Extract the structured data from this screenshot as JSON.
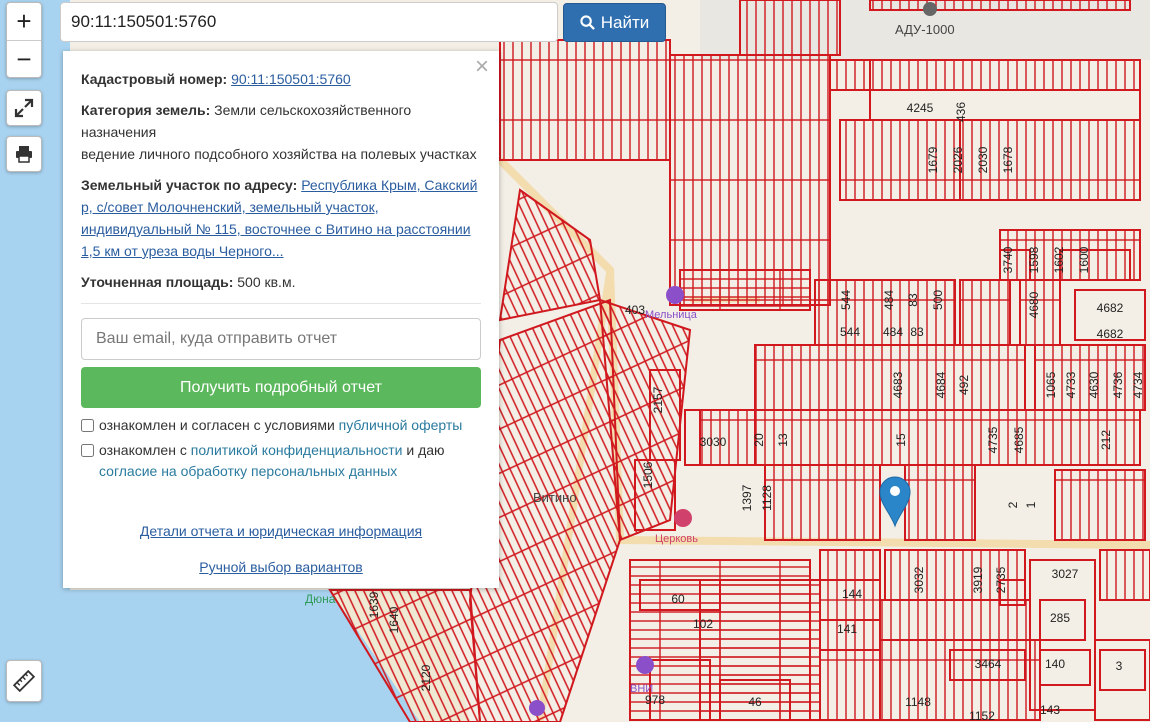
{
  "search": {
    "value": "90:11:150501:5760",
    "button_label": "Найти"
  },
  "controls": {
    "zoom_in": "+",
    "zoom_out": "−"
  },
  "info": {
    "cadastral_label": "Кадастровый номер:",
    "cadastral_value": "90:11:150501:5760",
    "category_label": "Категория земель:",
    "category_value": "Земли сельскохозяйственного назначения",
    "usage_value": "ведение личного подсобного хозяйства на полевых участках",
    "address_label": "Земельный участок по адресу:",
    "address_value": "Республика Крым, Сакский р, с/совет Молочненский, земельный участок, индивидуальный № 115, восточнее с Витино на расстоянии 1,5 км от уреза воды Черного...",
    "area_label": "Уточненная площадь:",
    "area_value": "500 кв.м.",
    "email_placeholder": "Ваш email, куда отправить отчет",
    "report_button": "Получить подробный отчет",
    "agree1_text": "ознакомлен и согласен с условиями ",
    "agree1_link": "публичной оферты",
    "agree2_text": "ознакомлен с ",
    "agree2_link": "политикой конфиденциальности",
    "agree2_mid": " и даю",
    "agree2_link2": "согласие на обработку персональных данных",
    "details_link": "Детали отчета и юридическая информация",
    "manual_link": "Ручной выбор вариантов",
    "close": "×"
  },
  "map": {
    "parcel_color": "#d0181e",
    "water_color": "#a8d3f0",
    "road_color": "#f3dcae",
    "places": [
      "АДУ-1000",
      "Витино",
      "Дюна"
    ],
    "pois": [
      "Мельница",
      "Церковь",
      "ВНИ"
    ],
    "parcels": [
      "4245",
      "436",
      "1679",
      "2026",
      "2030",
      "1678",
      "3740",
      "1598",
      "1602",
      "1600",
      "4682",
      "4682",
      "544",
      "484",
      "83",
      "500",
      "4680",
      "544",
      "484",
      "83",
      "403",
      "4683",
      "4684",
      "492",
      "1065",
      "4733",
      "4630",
      "4736",
      "4734",
      "2157",
      "3030",
      "20",
      "13",
      "15",
      "4735",
      "4685",
      "212",
      "1506",
      "1397",
      "1128",
      "2",
      "1",
      "3032",
      "3919",
      "2735",
      "3027",
      "60",
      "144",
      "102",
      "141",
      "285",
      "3464",
      "140",
      "3",
      "978",
      "46",
      "1148",
      "143",
      "1152",
      "1639",
      "1640",
      "2120"
    ]
  }
}
